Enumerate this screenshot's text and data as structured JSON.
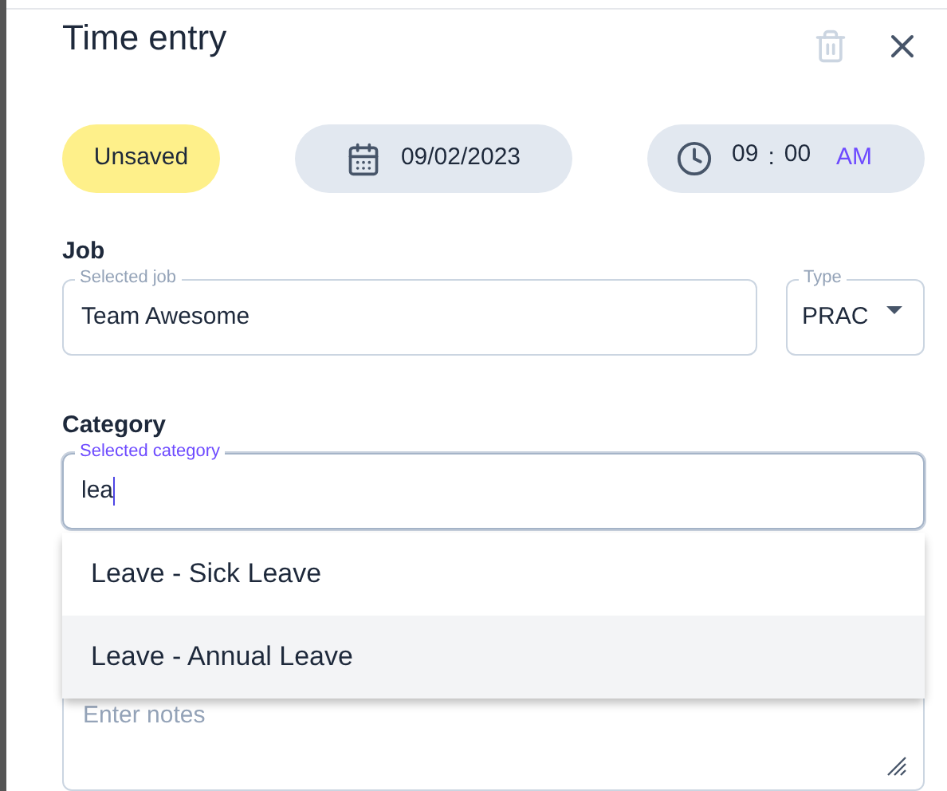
{
  "dialog": {
    "title": "Time entry",
    "delete_disabled": true
  },
  "status": {
    "label": "Unsaved",
    "color": "#fef08a"
  },
  "date": {
    "value": "09/02/2023"
  },
  "time": {
    "hours": "09",
    "separator": ":",
    "minutes": "00",
    "period": "AM"
  },
  "job": {
    "heading": "Job",
    "field": {
      "label": "Selected job",
      "value": "Team Awesome",
      "focused": false
    },
    "type": {
      "label": "Type",
      "value": "PRAC"
    }
  },
  "category": {
    "heading": "Category",
    "field": {
      "label": "Selected category",
      "value": "lea",
      "focused": true
    },
    "options": [
      {
        "label": "Leave - Sick Leave",
        "selected": false
      },
      {
        "label": "Leave - Annual Leave",
        "selected": true
      }
    ]
  },
  "notes": {
    "placeholder": "Enter notes"
  }
}
